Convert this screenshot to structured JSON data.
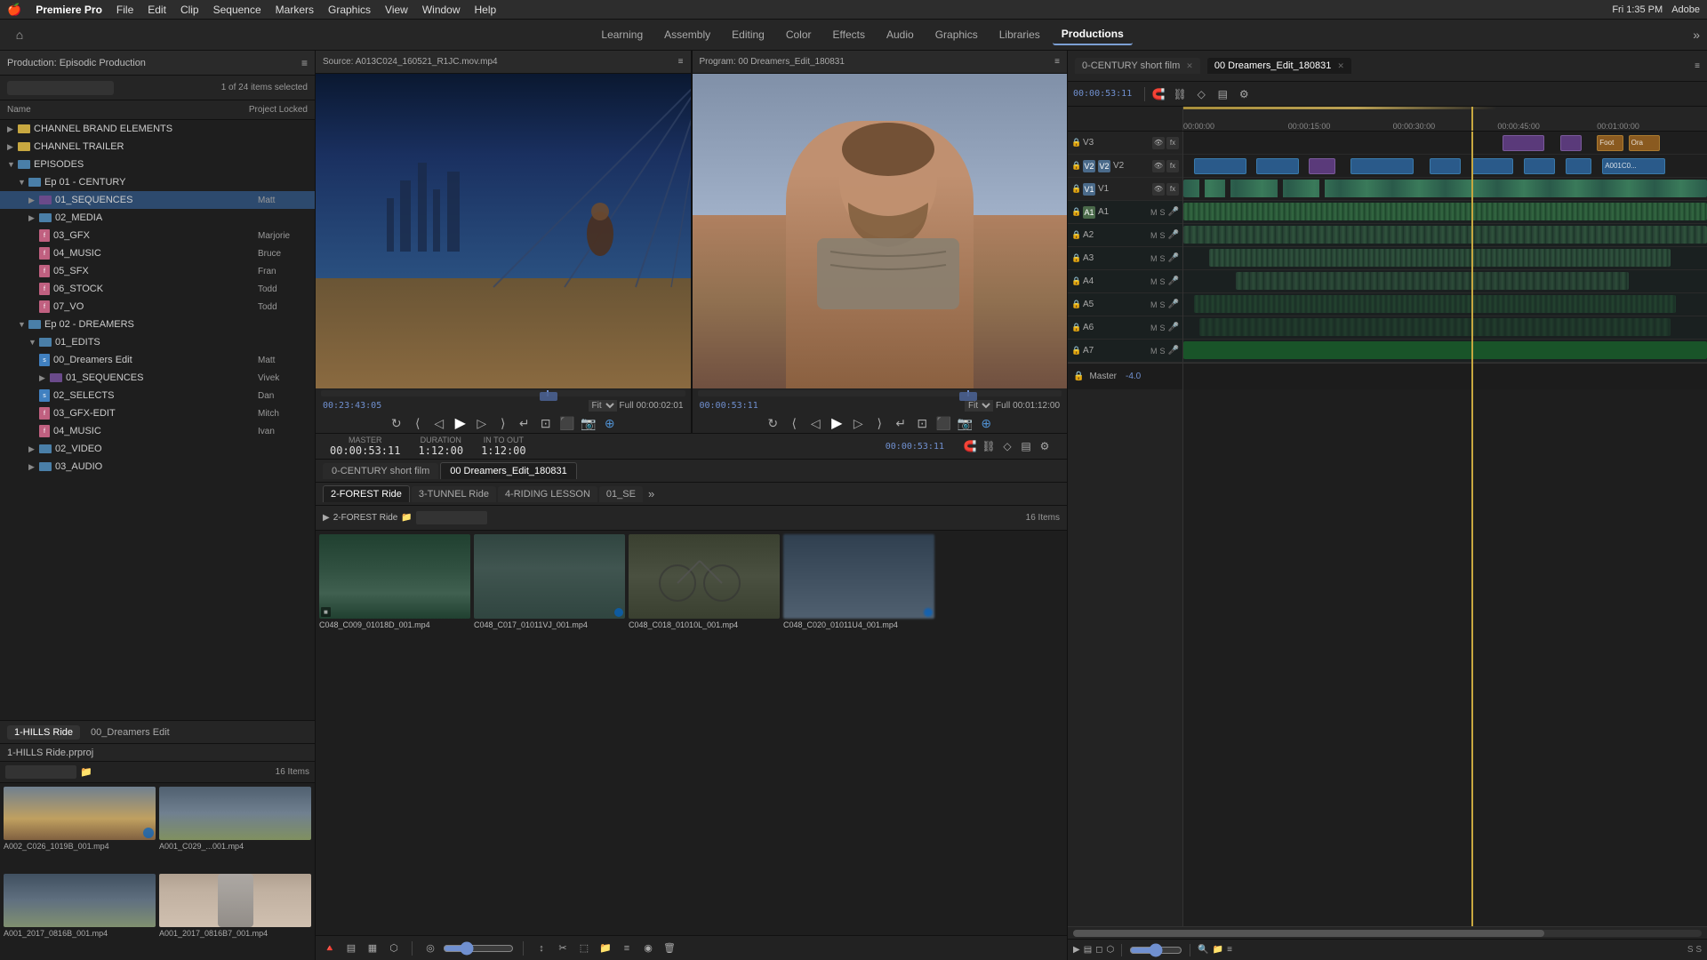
{
  "app": {
    "name": "Premiere Pro",
    "os": "macOS"
  },
  "menubar": {
    "apple": "🍎",
    "app_name": "Premiere Pro",
    "menus": [
      "File",
      "Edit",
      "Clip",
      "Sequence",
      "Markers",
      "Graphics",
      "View",
      "Window",
      "Help"
    ],
    "right": {
      "datetime": "Fri 1:35 PM",
      "adobe": "Adobe"
    }
  },
  "workspace": {
    "home_icon": "⌂",
    "tabs": [
      {
        "label": "Learning",
        "active": false
      },
      {
        "label": "Assembly",
        "active": false
      },
      {
        "label": "Editing",
        "active": false
      },
      {
        "label": "Color",
        "active": false
      },
      {
        "label": "Effects",
        "active": false
      },
      {
        "label": "Audio",
        "active": false
      },
      {
        "label": "Graphics",
        "active": false
      },
      {
        "label": "Libraries",
        "active": false
      },
      {
        "label": "Productions",
        "active": true
      }
    ],
    "more": "»"
  },
  "left_panel": {
    "title": "Production: Episodic Production",
    "menu_icon": "≡",
    "search_placeholder": "",
    "item_count": "1 of 24 items selected",
    "col_name": "Name",
    "col_locked": "Project Locked",
    "tree": [
      {
        "level": 0,
        "type": "folder_yellow",
        "label": "CHANNEL BRAND ELEMENTS",
        "user": ""
      },
      {
        "level": 0,
        "type": "folder_yellow",
        "label": "CHANNEL TRAILER",
        "user": ""
      },
      {
        "level": 0,
        "type": "folder_blue",
        "label": "EPISODES",
        "user": ""
      },
      {
        "level": 1,
        "type": "folder_blue",
        "label": "Ep 01 - CENTURY",
        "user": ""
      },
      {
        "level": 2,
        "type": "folder_purple",
        "label": "01_SEQUENCES",
        "user": "Matt",
        "selected": true
      },
      {
        "level": 2,
        "type": "folder_blue",
        "label": "02_MEDIA",
        "user": ""
      },
      {
        "level": 2,
        "type": "file_pink",
        "label": "03_GFX",
        "user": "Marjorie"
      },
      {
        "level": 2,
        "type": "file_pink",
        "label": "04_MUSIC",
        "user": "Bruce"
      },
      {
        "level": 2,
        "type": "file_pink",
        "label": "05_SFX",
        "user": "Fran"
      },
      {
        "level": 2,
        "type": "file_pink",
        "label": "06_STOCK",
        "user": "Todd"
      },
      {
        "level": 2,
        "type": "file_pink",
        "label": "07_VO",
        "user": "Todd"
      },
      {
        "level": 1,
        "type": "folder_blue",
        "label": "Ep 02 - DREAMERS",
        "user": ""
      },
      {
        "level": 2,
        "type": "folder_blue",
        "label": "01_EDITS",
        "user": ""
      },
      {
        "level": 3,
        "type": "file_blue",
        "label": "00_Dreamers Edit",
        "user": "Matt"
      },
      {
        "level": 3,
        "type": "folder_purple",
        "label": "01_SEQUENCES",
        "user": "Vivek"
      },
      {
        "level": 3,
        "type": "file_blue",
        "label": "02_SELECTS",
        "user": "Dan"
      },
      {
        "level": 3,
        "type": "file_pink",
        "label": "03_GFX-EDIT",
        "user": "Mitch"
      },
      {
        "level": 3,
        "type": "file_pink",
        "label": "04_MUSIC",
        "user": "Ivan"
      },
      {
        "level": 2,
        "type": "folder_blue",
        "label": "02_VIDEO",
        "user": ""
      },
      {
        "level": 2,
        "type": "folder_blue",
        "label": "03_AUDIO",
        "user": ""
      }
    ]
  },
  "bottom_left_panel": {
    "tabs": [
      "1-HILLS Ride",
      "00_Dreamers Edit"
    ],
    "active_tab": "1-HILLS Ride",
    "project_label": "1-HILLS Ride.prproj",
    "item_count": "16 Items",
    "thumbnails": [
      {
        "label": "A002_C026_1019B_001.mp4",
        "type": "aerial"
      },
      {
        "label": "A001_C029_...001.mp4",
        "type": "aerial2"
      },
      {
        "label": "A001_2017_0816B_001.mp4",
        "type": "aerial3"
      },
      {
        "label": "A001_2017_0816B7_001.mp4",
        "type": "portrait_thumb"
      }
    ]
  },
  "source_monitor": {
    "title": "Source: A013C024_160521_R1JC.mov.mp4",
    "menu_icon": "≡",
    "timecode": "00:23:43:05",
    "fit": "Fit",
    "quality": "Full",
    "duration": "00:00:02:01",
    "controls": [
      "⊲⊲",
      "◁",
      "▷",
      "▷▷",
      "↵"
    ]
  },
  "program_monitor": {
    "title": "Program: 00 Dreamers_Edit_180831",
    "menu_icon": "≡",
    "timecode": "00:00:53:11",
    "fit": "Fit",
    "quality": "Full",
    "duration": "00:01:12:00",
    "controls": [
      "⊲⊲",
      "◁",
      "▷",
      "▷▷",
      "↵"
    ]
  },
  "info_bar": {
    "master_label": "MASTER",
    "master_value": "00:00:53:11",
    "duration_label": "DURATION",
    "duration_value": "1:12:00",
    "in_to_out_label": "IN TO OUT",
    "in_to_out_value": "1:12:00"
  },
  "bin_tabs": [
    {
      "label": "0-CENTURY short film",
      "active": false
    },
    {
      "label": "00 Dreamers_Edit_180831",
      "active": true
    }
  ],
  "bin": {
    "project_label": "2-FOREST Ride",
    "project_icon": "▶",
    "search_placeholder": "",
    "item_count": "16 Items",
    "thumbnails": [
      {
        "label": "C048_C009_01018D_001.mp4",
        "type": "forest"
      },
      {
        "label": "C048_C017_01011VJ_001.mp4",
        "type": "forest2"
      },
      {
        "label": "C048_C018_01010L_001.mp4",
        "type": "cycling"
      },
      {
        "label": "C048_C020_01011U4_001.mp4",
        "type": "blur"
      }
    ],
    "sub_tabs": [
      "2-FOREST Ride",
      "3-TUNNEL Ride",
      "4-RIDING LESSON",
      "01_SE"
    ],
    "more_tabs": "»"
  },
  "timeline": {
    "tabs": [
      {
        "label": "0-CENTURY short film",
        "active": false
      },
      {
        "label": "00 Dreamers_Edit_180831",
        "active": true
      }
    ],
    "current_time": "00:00:53:11",
    "timecode_display": "00:00:53:11",
    "ruler": {
      "marks": [
        "00:00:00",
        "00:00:15:00",
        "00:00:30:00",
        "00:00:45:00",
        "00:01:00:00"
      ]
    },
    "tracks": {
      "video": [
        {
          "name": "V3",
          "height": "normal"
        },
        {
          "name": "V2",
          "height": "normal"
        },
        {
          "name": "V1",
          "height": "normal"
        }
      ],
      "audio": [
        {
          "name": "A1",
          "height": "normal"
        },
        {
          "name": "A2",
          "height": "normal"
        },
        {
          "name": "A3",
          "height": "normal"
        },
        {
          "name": "A4",
          "height": "normal"
        },
        {
          "name": "A5",
          "height": "normal"
        },
        {
          "name": "A6",
          "height": "normal"
        },
        {
          "name": "A7",
          "height": "normal"
        }
      ],
      "master": {
        "name": "Master",
        "value": "-4.0"
      }
    },
    "tools": [
      "▶",
      "◻",
      "✂",
      "↔",
      "🖊",
      "🔊"
    ],
    "playhead_position": "43%"
  },
  "bottom_toolbar": {
    "buttons": [
      "🔺",
      "▤",
      "▦",
      "⬜",
      "◎",
      "↕",
      "✂",
      "◉",
      "📁",
      "≡",
      "⚙"
    ]
  }
}
